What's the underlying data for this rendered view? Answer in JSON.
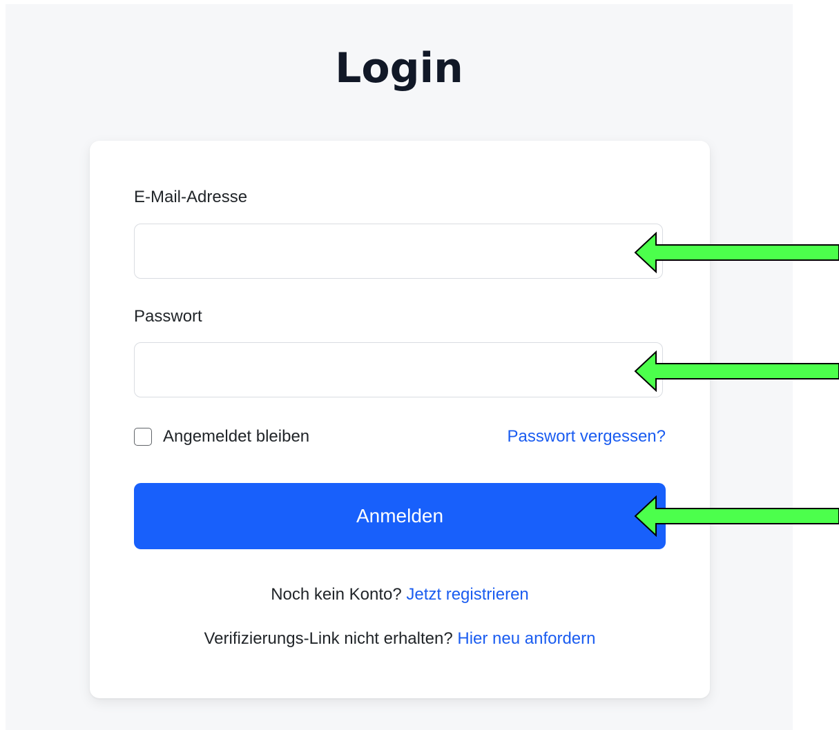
{
  "title": "Login",
  "form": {
    "email_label": "E-Mail-Adresse",
    "email_value": "",
    "password_label": "Passwort",
    "password_value": "",
    "remember_label": "Angemeldet bleiben",
    "remember_checked": false,
    "forgot_link": "Passwort vergessen?",
    "submit_label": "Anmelden"
  },
  "footer": {
    "register_prefix": "Noch kein Konto?",
    "register_link": "Jetzt registrieren",
    "verify_prefix": "Verifizierungs-Link nicht erhalten?",
    "verify_link": "Hier neu anfordern"
  },
  "colors": {
    "accent": "#1860fb",
    "link": "#1a5cf0",
    "annotation_arrow": "#4cff4c"
  },
  "annotations": [
    {
      "icon": "arrow-left-icon",
      "target": "email-field"
    },
    {
      "icon": "arrow-left-icon",
      "target": "password-field"
    },
    {
      "icon": "arrow-left-icon",
      "target": "login-button"
    }
  ]
}
